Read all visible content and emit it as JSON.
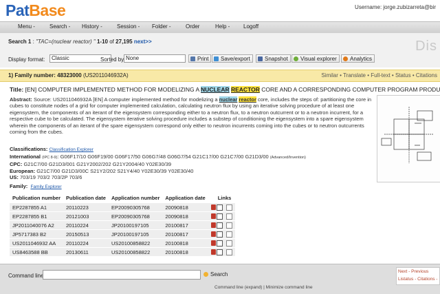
{
  "header": {
    "logo_part1": "Pat",
    "logo_part2": "Base",
    "username": "Username: jorge.zubizarreta@bir"
  },
  "menu": {
    "items": [
      "Menu -",
      "Search -",
      "History -",
      "Session -",
      "Folder -",
      "Order",
      "Help -",
      "Logoff"
    ]
  },
  "search": {
    "label": "Search 1",
    "query": "\"TAC=(nuclear reactor) \"",
    "range": "1-10",
    "of_label": "of",
    "total": "27,195",
    "next_label": "next>>",
    "display_word": "Dis"
  },
  "toolbar": {
    "display_format_label": "Display format:",
    "display_format_value": "Classic",
    "sorted_by_label": "Sorted by:",
    "sorted_by_value": "None",
    "buttons": [
      "Print",
      "Save/export",
      "Snapshot",
      "Visual explorer",
      "Analytics"
    ],
    "button_colors": [
      "#5577aa",
      "#3f8fd4",
      "#4a68a0",
      "#6fae3a",
      "#e07a1a"
    ]
  },
  "family": {
    "number_label": "1) Family number: 48323000",
    "number_suffix": "(US2011046932A)",
    "links": "Similar • Translate • Full-text • Status • Citations"
  },
  "title": {
    "label": "Title:",
    "prefix": "[EN] COMPUTER IMPLEMENTED METHOD FOR MODELIZING A",
    "hl1": "NUCLEAR",
    "hl2": "REACTOR",
    "suffix": "CORE AND A CORRESPONDING COMPUTER PROGRAM PRODUCT"
  },
  "abstract": {
    "label": "Abstract:",
    "part1": "Source: US2011046932A [EN] A computer implemented method for modelizing a",
    "hl1": "nuclear",
    "hl2": "reactor",
    "part2": "core, includes the steps of: partitioning the core in cubes to constitute nodes of a grid for computer implemented calculation, calculating neutron flux by using an iterative solving procedure of at least one eigensystem, the components of an iterant of the eigensystem corresponding either to a neutron flux, to a neutron outcurrent or to a neutron incurrent, for a respective cube to be calculated. The eigensystem iterative solving procedure includes a substep of conditioning the eigensystem into a spare eigensystem wherein the components of an iterant of the spare eigensystem correspond only either to neutron incurrents coming into the cubes or to neutron outcurrents coming from the cubes."
  },
  "classifications": {
    "label": "Classifications:",
    "explorer": "Classification Explorer",
    "international_label": "International",
    "international_small": "(IPC 8-9)",
    "international": "G06F17/10 G06F19/00 G06F17/50 G06G7/48 G06G7/54 G21C17/00 G21C7/00 G21D3/00",
    "international_suffix": "(Advanced/Invention)",
    "cpc_label": "CPC:",
    "cpc": "G21C7/00 G21D3/001 G21Y2002/202 G21Y2004/40 Y02E30/39",
    "european_label": "European:",
    "european": "G21C7/00 G21D3/00C S21Y2/202 S21Y4/40 Y02E30/39 Y02E30/40",
    "us_label": "US:",
    "us": "703/19 703/2 703/2P 703/6"
  },
  "family_section": {
    "label": "Family:",
    "explorer": "Family Explorer"
  },
  "table": {
    "headers": [
      "Publication number",
      "Publication date",
      "Application number",
      "Application date",
      "Links"
    ],
    "rows": [
      [
        "EP2287855 A1",
        "20110223",
        "EP20090305768",
        "20090818"
      ],
      [
        "EP2287855 B1",
        "20121003",
        "EP20090305768",
        "20090818"
      ],
      [
        "JP2011040076 A2",
        "20110224",
        "JP20100197105",
        "20100817"
      ],
      [
        "JP5717383 B2",
        "20150513",
        "JP20100197105",
        "20100817"
      ],
      [
        "US2011046932 AA",
        "20110224",
        "US20100858822",
        "20100818"
      ],
      [
        "US8463588 BB",
        "20130611",
        "US20100858822",
        "20100818"
      ]
    ]
  },
  "footer": {
    "command_label": "Command line:",
    "search_label": "Search",
    "subline": "Command line (expand)  |  Minimize command line",
    "nav_line1": "Next - Previous",
    "nav_line2": "Listatus - Citations -"
  }
}
